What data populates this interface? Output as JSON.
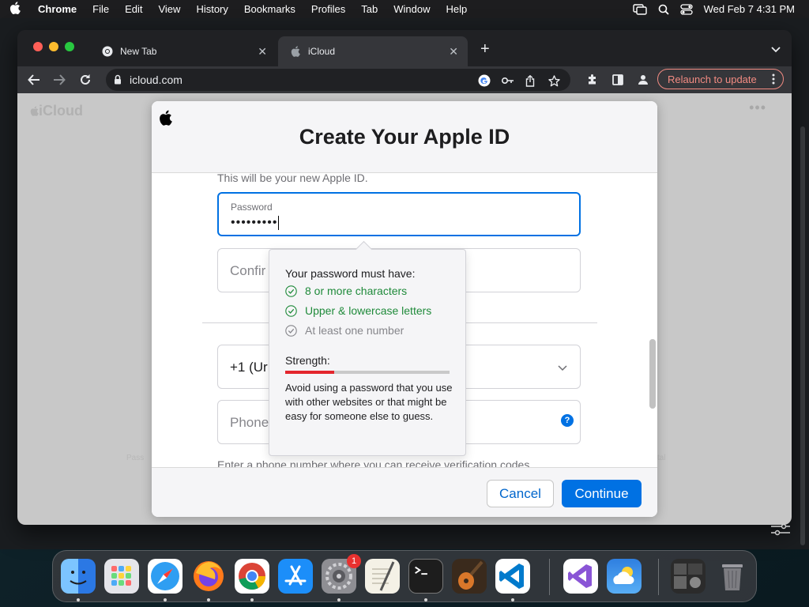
{
  "menubar": {
    "app_name": "Chrome",
    "items": [
      "File",
      "Edit",
      "View",
      "History",
      "Bookmarks",
      "Profiles",
      "Tab",
      "Window",
      "Help"
    ],
    "clock": "Wed Feb 7  4:31 PM"
  },
  "browser": {
    "tabs": [
      {
        "title": "New Tab",
        "icon": "chrome-icon"
      },
      {
        "title": "iCloud",
        "icon": "apple-icon"
      }
    ],
    "url": "icloud.com",
    "relaunch_label": "Relaunch to update"
  },
  "page": {
    "logo_text": "iCloud",
    "faint_left": "Pass",
    "faint_right": "tal"
  },
  "modal": {
    "title": "Create Your Apple ID",
    "subtext": "This will be your new Apple ID.",
    "password_label": "Password",
    "password_value": "•••••••••",
    "confirm_placeholder": "Confir",
    "country_value": "+1 (Ur",
    "phone_placeholder": "Phone",
    "help_glyph": "?",
    "bottom_text": "Enter a phone number where you can receive verification codes",
    "cancel_label": "Cancel",
    "continue_label": "Continue"
  },
  "password_popover": {
    "title": "Your password must have:",
    "requirements": [
      {
        "text": "8 or more characters",
        "met": true
      },
      {
        "text": "Upper & lowercase letters",
        "met": true
      },
      {
        "text": "At least one number",
        "met": false
      }
    ],
    "strength_label": "Strength:",
    "strength_fraction": 0.3,
    "advice": "Avoid using a password that you use with other websites or that might be easy for someone else to guess."
  },
  "dock": {
    "apps": [
      {
        "name": "Finder",
        "color": "#3b8df5",
        "running": true
      },
      {
        "name": "Launchpad",
        "color": "#e3e3e3",
        "running": false
      },
      {
        "name": "Safari",
        "color": "#2f9ef2",
        "running": true
      },
      {
        "name": "Firefox",
        "color": "#ff7a1a",
        "running": true
      },
      {
        "name": "Chrome",
        "color": "#ffffff",
        "running": true
      },
      {
        "name": "App Store",
        "color": "#1c8ef9",
        "running": false
      },
      {
        "name": "System Settings",
        "color": "#8e8e93",
        "running": true,
        "badge": "1"
      },
      {
        "name": "TextEdit",
        "color": "#f4f1e6",
        "running": false
      },
      {
        "name": "Terminal",
        "color": "#1d1d1d",
        "running": true
      },
      {
        "name": "GarageBand",
        "color": "#d9772a",
        "running": false
      },
      {
        "name": "Visual Studio Code",
        "color": "#ffffff",
        "running": true
      },
      {
        "name": "Visual Studio",
        "color": "#ffffff",
        "running": false
      },
      {
        "name": "Weather",
        "color": "#3b8ee8",
        "running": false
      },
      {
        "name": "Screenshot Stack",
        "color": "#2b2b2b",
        "running": false
      },
      {
        "name": "Trash",
        "color": "#7d7d82",
        "running": false
      }
    ]
  }
}
